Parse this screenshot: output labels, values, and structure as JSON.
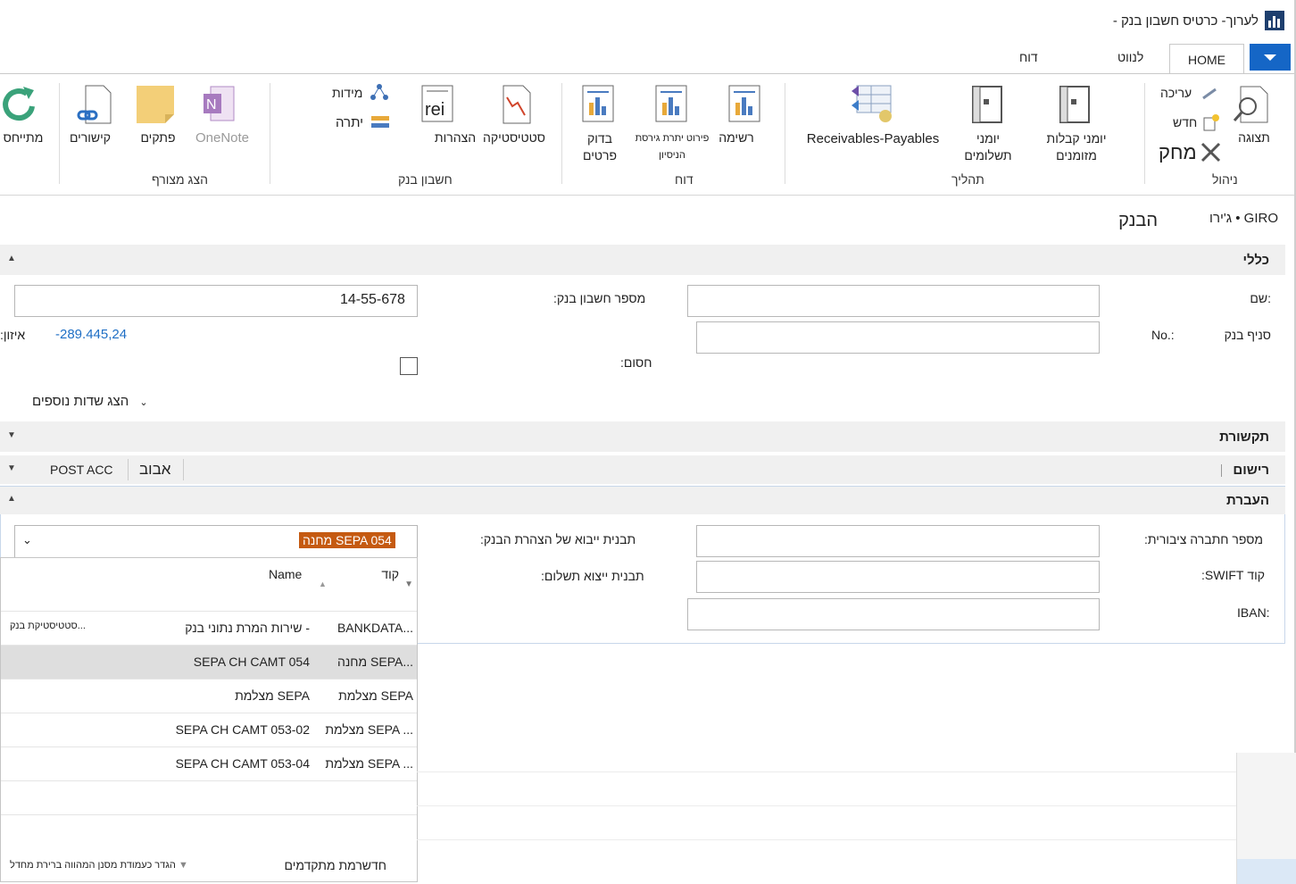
{
  "window": {
    "title": "לערוך- כרטיס חשבון בנק -"
  },
  "tabs": {
    "home": "HOME",
    "navigate": "לנווט",
    "report": "דוח"
  },
  "ribbon": {
    "manage": {
      "group": "ניהול",
      "view": "תצוגה",
      "edit": "עריכה",
      "new": "חדש",
      "delete": "מחק"
    },
    "process": {
      "group": "תהליך",
      "cash_receipt": "יומני קבלות מזומנים",
      "payment": "יומני תשלומים",
      "receivables_payables": "Receivables-Payables"
    },
    "report": {
      "group": "דוח",
      "list": "רשימה",
      "trial_balance": "פירוט יתרת גירסת הניסיון",
      "check_details": "בדוק פרטים"
    },
    "bank_account": {
      "group": "חשבון בנק",
      "statistics": "סטטיסטיקה",
      "statements": "הצהרות",
      "dimensions": "מידות",
      "balance": "יתרה"
    },
    "show_attached": {
      "group": "הצג מצורף",
      "onenote": "OneNote",
      "notes": "פתקים",
      "links": "קישורים"
    },
    "page": {
      "refresh": "מתייחס"
    }
  },
  "header": {
    "code": "GIRO • ג'ירו",
    "name": "הבנק"
  },
  "general": {
    "title": "כללי",
    "name_label": "שם:",
    "name_value": "",
    "branch_label": "סניף בנק",
    "branch_no_label": "No.:",
    "branch_value": "",
    "account_no_label": "מספר חשבון בנק:",
    "account_no_value": "14-55-678",
    "blocked_label": "חסום:",
    "balance_label": "איזון:",
    "balance_value": "-289.445,24",
    "show_more": "הצג שדות נוספים"
  },
  "communication": {
    "title": "תקשורת"
  },
  "posting": {
    "title": "רישום",
    "value1": "אבוב",
    "value2": "POST ACC"
  },
  "transfer": {
    "title": "העברת",
    "public_company_label": "מספר חתברה ציבורית:",
    "swift_label": "קוד SWIFT:",
    "iban_label": "IBAN:",
    "import_format_label": "תבנית ייבוא של הצהרת הבנק:",
    "export_format_label": "תבנית ייצוא תשלום:",
    "import_format_value": "מחנה SEPA 054"
  },
  "dropdown": {
    "col_code": "קוד",
    "col_name": "Name",
    "rows": [
      {
        "code": "BANKDATA...",
        "name": "שירות המרת נתוני בנק -",
        "extra": "סטטיסטיקת בנק..."
      },
      {
        "code": "מחנה SEPA...",
        "name": "SEPA CH CAMT 054",
        "extra": ""
      },
      {
        "code": "מצלמת SEPA",
        "name": "מצלמת SEPA",
        "extra": ""
      },
      {
        "code": "מצלמת SEPA ...",
        "name": "SEPA CH CAMT 053-02",
        "extra": ""
      },
      {
        "code": "מצלמת SEPA ...",
        "name": "SEPA CH CAMT 053-04",
        "extra": ""
      }
    ],
    "footer_new": "חדשרמת מתקדמים",
    "footer_filter": "הגדר כעמודת מסנן המהווה ברירת מחדל"
  },
  "colors": {
    "accent": "#1566c6",
    "selection": "#c55a11",
    "link": "#1f6fc5"
  }
}
